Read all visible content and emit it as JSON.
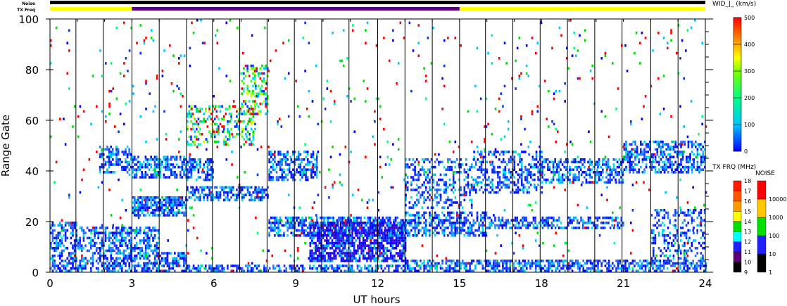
{
  "chart_data": {
    "type": "heatmap",
    "xlabel": "UT hours",
    "ylabel": "Range Gate",
    "xlim": [
      0,
      24
    ],
    "ylim": [
      0,
      100
    ],
    "xticks": [
      "0",
      "3",
      "6",
      "9",
      "12",
      "15",
      "18",
      "21",
      "24"
    ],
    "yticks": [
      "0",
      "20",
      "40",
      "60",
      "80",
      "100"
    ],
    "hour_lines": [
      0.95,
      1.95,
      3,
      4,
      5,
      5.95,
      6.95,
      7.95,
      8.95,
      9.95,
      10.95,
      12,
      13,
      14,
      15,
      15.95,
      16.95,
      17.95,
      18.95,
      19.95,
      20.95,
      22,
      23
    ],
    "noise_label": "Noise",
    "txfreq_label": "TX Freq",
    "txfreq_segments": [
      {
        "from": 0,
        "to": 3,
        "color": "#ffff00"
      },
      {
        "from": 3,
        "to": 15,
        "color": "#5a0078"
      },
      {
        "from": 15,
        "to": 24,
        "color": "#ffff00"
      }
    ],
    "echo_regions": [
      {
        "t": [
          0,
          1
        ],
        "g": [
          0,
          20
        ],
        "d": 0.55,
        "c": "blue"
      },
      {
        "t": [
          1,
          2
        ],
        "g": [
          0,
          18
        ],
        "d": 0.45,
        "c": "blue"
      },
      {
        "t": [
          2,
          4
        ],
        "g": [
          0,
          18
        ],
        "d": 0.6,
        "c": "blue"
      },
      {
        "t": [
          4,
          5
        ],
        "g": [
          0,
          8
        ],
        "d": 0.6,
        "c": "blue"
      },
      {
        "t": [
          1.8,
          3
        ],
        "g": [
          39,
          50
        ],
        "d": 0.5,
        "c": "blue"
      },
      {
        "t": [
          3,
          5.2
        ],
        "g": [
          37,
          46
        ],
        "d": 0.65,
        "c": "blue"
      },
      {
        "t": [
          5,
          6
        ],
        "g": [
          36,
          45
        ],
        "d": 0.55,
        "c": "blue"
      },
      {
        "t": [
          3,
          5
        ],
        "g": [
          22,
          30
        ],
        "d": 0.75,
        "c": "blue"
      },
      {
        "t": [
          5,
          8
        ],
        "g": [
          28,
          34
        ],
        "d": 0.6,
        "c": "blue"
      },
      {
        "t": [
          5,
          13
        ],
        "g": [
          0,
          3
        ],
        "d": 0.55,
        "c": "blue"
      },
      {
        "t": [
          5,
          7.5
        ],
        "g": [
          50,
          66
        ],
        "d": 0.35,
        "c": "green"
      },
      {
        "t": [
          7,
          8
        ],
        "g": [
          62,
          82
        ],
        "d": 0.35,
        "c": "green"
      },
      {
        "t": [
          8,
          9.8
        ],
        "g": [
          36,
          48
        ],
        "d": 0.55,
        "c": "blue"
      },
      {
        "t": [
          8,
          13
        ],
        "g": [
          14,
          22
        ],
        "d": 0.6,
        "c": "blue"
      },
      {
        "t": [
          9.5,
          13
        ],
        "g": [
          4,
          20
        ],
        "d": 0.75,
        "c": "purple"
      },
      {
        "t": [
          13,
          15.5
        ],
        "g": [
          25,
          45
        ],
        "d": 0.35,
        "c": "blue"
      },
      {
        "t": [
          13,
          16
        ],
        "g": [
          14,
          24
        ],
        "d": 0.5,
        "c": "blue"
      },
      {
        "t": [
          13,
          24
        ],
        "g": [
          0,
          5
        ],
        "d": 0.6,
        "c": "blue"
      },
      {
        "t": [
          15.5,
          18
        ],
        "g": [
          31,
          48
        ],
        "d": 0.45,
        "c": "blue"
      },
      {
        "t": [
          18,
          21
        ],
        "g": [
          35,
          45
        ],
        "d": 0.55,
        "c": "blue"
      },
      {
        "t": [
          21,
          24
        ],
        "g": [
          39,
          52
        ],
        "d": 0.55,
        "c": "blue"
      },
      {
        "t": [
          16,
          21
        ],
        "g": [
          17,
          22
        ],
        "d": 0.5,
        "c": "blue"
      },
      {
        "t": [
          22,
          24
        ],
        "g": [
          5,
          25
        ],
        "d": 0.35,
        "c": "blue"
      },
      {
        "t": [
          0,
          24
        ],
        "g": [
          0,
          100
        ],
        "d": 0.02,
        "c": "mixed"
      }
    ],
    "colorbars": {
      "width": {
        "title": "WID_|_ (km/s)",
        "ticks": [
          "0",
          "100",
          "200",
          "300",
          "400",
          "500"
        ]
      },
      "txfreq": {
        "title": "TX FRQ (MHz)",
        "ticks": [
          "9",
          "10",
          "11",
          "12",
          "13",
          "14",
          "15",
          "16",
          "17",
          "18"
        ],
        "colors": [
          "#000000",
          "#5a0078",
          "#2020ff",
          "#00ffff",
          "#00e000",
          "#ffff00",
          "#ff9900",
          "#ff5500",
          "#ff1a00"
        ]
      },
      "noise": {
        "title": "NOISE",
        "ticks": [
          "1",
          "10",
          "100",
          "1000",
          "10000"
        ],
        "colors": [
          "#000000",
          "#2020ff",
          "#00e000",
          "#ffc800",
          "#ff0000"
        ]
      }
    }
  }
}
